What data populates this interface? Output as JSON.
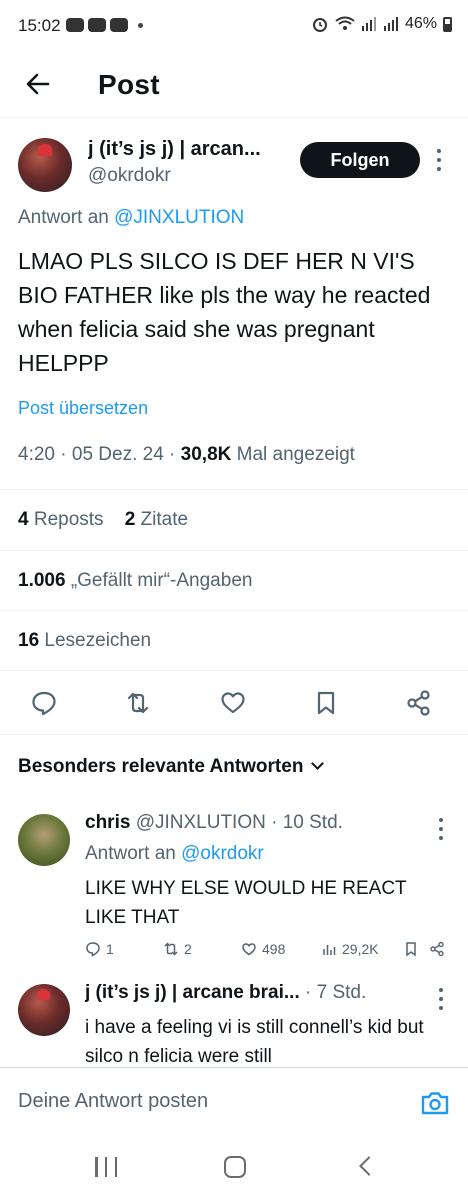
{
  "status_bar": {
    "time": "15:02",
    "battery": "46%",
    "icons": [
      "game-controller-icon",
      "game-controller-icon",
      "youtube-icon",
      "alarm-icon",
      "wifi-icon",
      "signal-icon",
      "signal-icon",
      "battery-icon"
    ]
  },
  "header": {
    "title": "Post",
    "back_icon": "arrow-left-icon"
  },
  "post": {
    "author_name": "j (it’s js j) | arcan...",
    "author_handle": "@okrdokr",
    "follow_label": "Folgen",
    "reply_to_prefix": "Antwort an",
    "reply_to_mention": "@JINXLUTION",
    "text": "LMAO PLS SILCO IS DEF HER N VI'S BIO FATHER like pls the way he reacted when felicia said she was pregnant HELPPP",
    "translate_label": "Post übersetzen",
    "time": "4:20",
    "date": "05 Dez. 24",
    "views_count": "30,8K",
    "views_label": "Mal angezeigt",
    "reposts_count": "4",
    "reposts_label": "Reposts",
    "quotes_count": "2",
    "quotes_label": "Zitate",
    "likes_count": "1.006",
    "likes_label": "„Gefällt mir“-Angaben",
    "bookmarks_count": "16",
    "bookmarks_label": "Lesezeichen"
  },
  "replies_section": {
    "sort_label": "Besonders relevante Antworten"
  },
  "replies": [
    {
      "name": "chris",
      "meta": "@JINXLUTION · 10 Std.",
      "reply_to_prefix": "Antwort an",
      "reply_to_mention": "@okrdokr",
      "text": "LIKE WHY ELSE WOULD HE REACT LIKE THAT",
      "reply_count": "1",
      "repost_count": "2",
      "like_count": "498",
      "view_count": "29,2K"
    },
    {
      "name": "j (it’s js j) | arcane brai...",
      "meta": "· 7 Std.",
      "text": "i have a feeling vi is still connell’s kid but silco n felicia were still"
    }
  ],
  "composer": {
    "placeholder": "Deine Antwort posten"
  },
  "colors": {
    "accent": "#1d9bf0",
    "text": "#0f1419",
    "secondary": "#536471",
    "divider": "#eff3f4"
  }
}
